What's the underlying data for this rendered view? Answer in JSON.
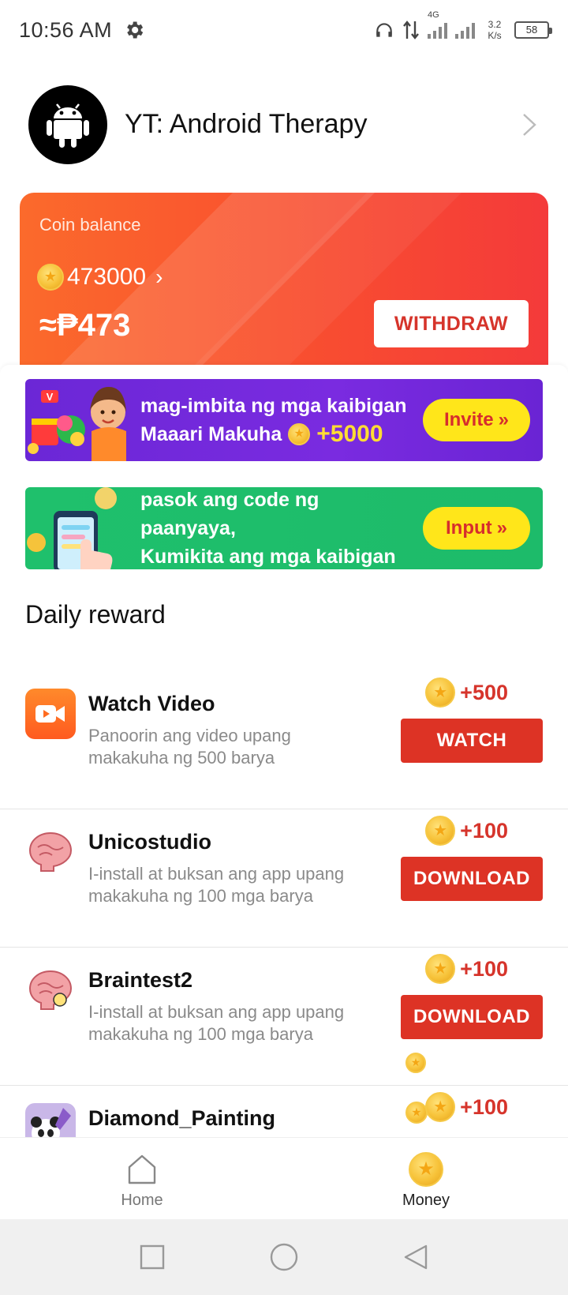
{
  "status_bar": {
    "time": "10:56 AM",
    "network_type": "4G",
    "speed_value": "3.2",
    "speed_unit": "K/s",
    "battery": "58"
  },
  "profile": {
    "name": "YT: Android Therapy"
  },
  "coin_card": {
    "label": "Coin balance",
    "coins": "473000",
    "peso_value": "≈₱473",
    "withdraw_label": "WITHDRAW"
  },
  "banners": {
    "invite": {
      "line1": "mag-imbita ng mga kaibigan",
      "line2_prefix": "Maaari Makuha",
      "bonus": "+5000",
      "button": "Invite",
      "color": "#6b27d6"
    },
    "input": {
      "line1": "pasok ang code ng paanyaya,",
      "line2": "Kumikita ang mga kaibigan",
      "button": "Input",
      "color": "#1fc06c"
    }
  },
  "daily_reward": {
    "title": "Daily reward",
    "tasks": [
      {
        "title": "Watch Video",
        "desc": "Panoorin ang video upang makakuha ng 500 barya",
        "reward": "+500",
        "action": "WATCH",
        "icon": "video-play-icon"
      },
      {
        "title": "Unicostudio",
        "desc": "I-install at buksan ang app upang makakuha ng 100 mga barya",
        "reward": "+100",
        "action": "DOWNLOAD",
        "icon": "brain-app-icon"
      },
      {
        "title": "Braintest2",
        "desc": "I-install at buksan ang app upang makakuha ng 100 mga barya",
        "reward": "+100",
        "action": "DOWNLOAD",
        "icon": "brain-app-icon"
      },
      {
        "title": "Diamond_Painting",
        "reward": "+100",
        "icon": "panda-app-icon"
      }
    ]
  },
  "bottom_nav": {
    "home_label": "Home",
    "money_label": "Money"
  },
  "colors": {
    "accent_red": "#dd3325",
    "card_gradient_start": "#fb6a2c",
    "card_gradient_end": "#f43a3a",
    "coin_gold": "#f7c33a"
  }
}
